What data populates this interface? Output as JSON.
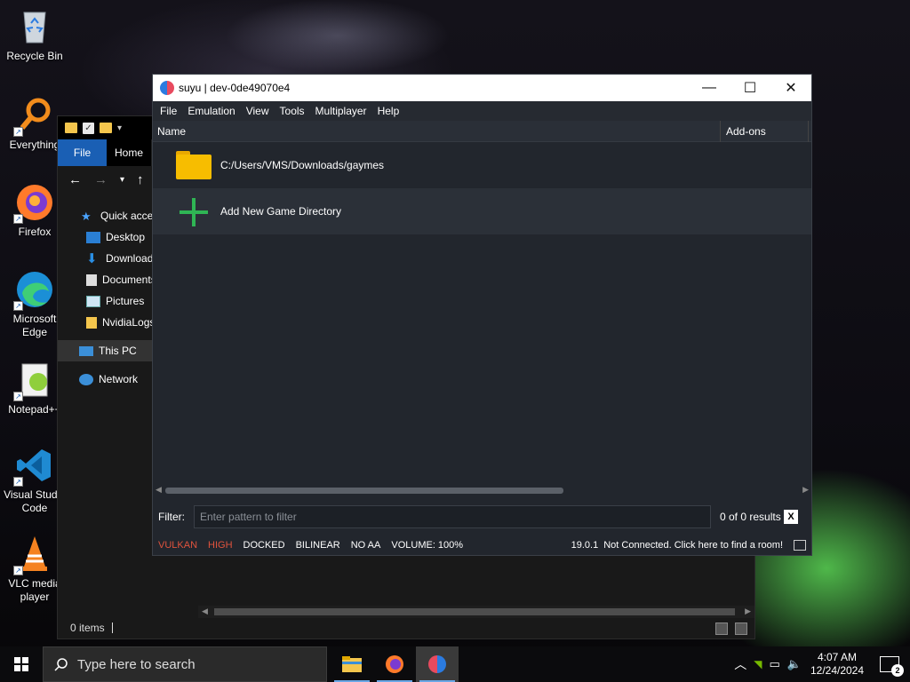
{
  "desktop": {
    "icons": [
      {
        "label": "Recycle Bin"
      },
      {
        "label": "Everything"
      },
      {
        "label": "Firefox"
      },
      {
        "label": "Microsoft Edge"
      },
      {
        "label": "Notepad++"
      },
      {
        "label": "Visual Studio Code"
      },
      {
        "label": "VLC media player"
      }
    ]
  },
  "explorer": {
    "ribbon": {
      "file": "File",
      "home": "Home"
    },
    "sidebar": [
      {
        "label": "Quick access"
      },
      {
        "label": "Desktop"
      },
      {
        "label": "Downloads"
      },
      {
        "label": "Documents"
      },
      {
        "label": "Pictures"
      },
      {
        "label": "NvidiaLogs"
      },
      {
        "label": "This PC"
      },
      {
        "label": "Network"
      }
    ],
    "status": "0 items"
  },
  "suyu": {
    "title": "suyu | dev-0de49070e4",
    "menu": [
      "File",
      "Emulation",
      "View",
      "Tools",
      "Multiplayer",
      "Help"
    ],
    "columns": {
      "name": "Name",
      "addons": "Add-ons"
    },
    "rows": [
      {
        "label": "C:/Users/VMS/Downloads/gaymes",
        "icon": "folder-icon"
      },
      {
        "label": "Add New Game Directory",
        "icon": "plus-icon"
      }
    ],
    "filter": {
      "label": "Filter:",
      "placeholder": "Enter pattern to filter",
      "results": "0 of 0 results",
      "clear": "X"
    },
    "status": {
      "api": "VULKAN",
      "accuracy": "HIGH",
      "mode": "DOCKED",
      "filter": "BILINEAR",
      "aa": "NO AA",
      "volume": "VOLUME: 100%",
      "version": "19.0.1",
      "network": "Not Connected. Click here to find a room!"
    },
    "colors": {
      "warn": "#e0533d",
      "accent": "#2fb554"
    }
  },
  "taskbar": {
    "search_placeholder": "Type here to search",
    "time": "4:07 AM",
    "date": "12/24/2024",
    "notifications": "2"
  }
}
